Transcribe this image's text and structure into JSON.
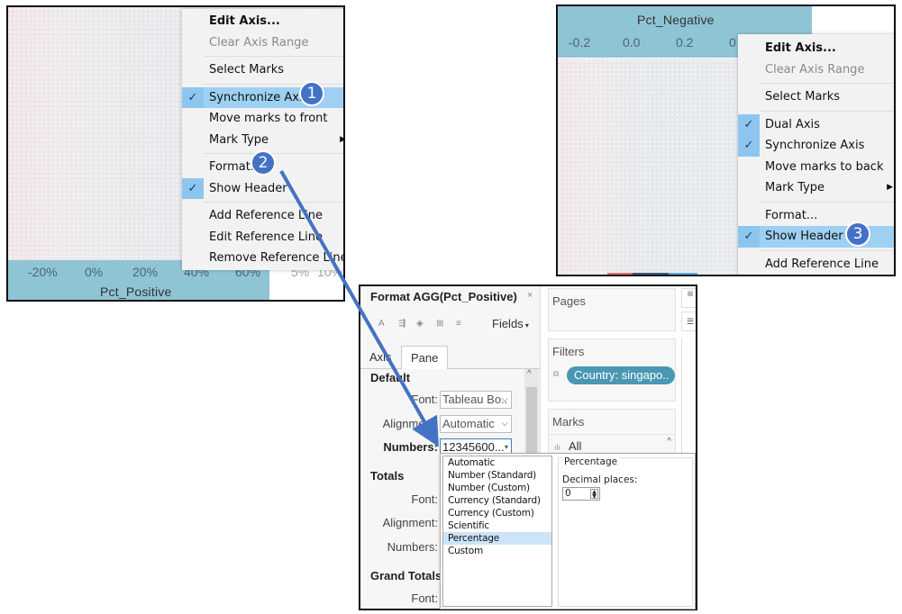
{
  "left_panel": {
    "axis_ticks": [
      "-20%",
      "0%",
      "20%",
      "40%",
      "60%"
    ],
    "secondary_ticks": [
      "5%",
      "10%"
    ],
    "axis_title": "Pct_Positive",
    "context_menu": {
      "items": [
        {
          "label": "Edit Axis...",
          "style": "bold",
          "checked": false
        },
        {
          "label": "Clear Axis Range",
          "style": "disabled",
          "checked": false
        },
        {
          "sep": true
        },
        {
          "label": "Select Marks",
          "checked": false
        },
        {
          "sep": true
        },
        {
          "label": "Synchronize Axis",
          "checked": true,
          "highlighted": true
        },
        {
          "label": "Move marks to front",
          "checked": false
        },
        {
          "label": "Mark Type",
          "checked": false,
          "submenu": true
        },
        {
          "sep": true
        },
        {
          "label": "Format...",
          "checked": false
        },
        {
          "label": "Show Header",
          "checked": true
        },
        {
          "sep": true
        },
        {
          "label": "Add Reference Line",
          "checked": false
        },
        {
          "label": "Edit Reference Line",
          "checked": false
        },
        {
          "label": "Remove Reference Line",
          "checked": false
        }
      ]
    },
    "badges": [
      "1",
      "2"
    ]
  },
  "right_panel": {
    "axis_title": "Pct_Negative",
    "axis_ticks": [
      "-0.2",
      "0.0",
      "0.2",
      "0"
    ],
    "context_menu": {
      "items": [
        {
          "label": "Edit Axis...",
          "style": "bold",
          "checked": false
        },
        {
          "label": "Clear Axis Range",
          "style": "disabled",
          "checked": false
        },
        {
          "sep": true
        },
        {
          "label": "Select Marks",
          "checked": false
        },
        {
          "sep": true
        },
        {
          "label": "Dual Axis",
          "checked": true
        },
        {
          "label": "Synchronize Axis",
          "checked": true
        },
        {
          "label": "Move marks to back",
          "checked": false
        },
        {
          "label": "Mark Type",
          "checked": false,
          "submenu": true
        },
        {
          "sep": true
        },
        {
          "label": "Format...",
          "checked": false
        },
        {
          "label": "Show Header",
          "checked": true,
          "highlighted": true
        },
        {
          "sep": true
        },
        {
          "label": "Add Reference Line",
          "checked": false
        }
      ]
    },
    "badge": "3"
  },
  "format_pane": {
    "title": "Format AGG(Pct_Positive)",
    "close": "×",
    "toolbar_icons": [
      "font-icon",
      "align-icon",
      "shading-icon",
      "borders-icon",
      "lines-icon"
    ],
    "fields_label": "Fields",
    "tabs": [
      "Axis",
      "Pane"
    ],
    "active_tab": "Pane",
    "sections": {
      "default": {
        "title": "Default",
        "font_label": "Font:",
        "font_value": "Tableau Bo..",
        "alignment_label": "Alignment:",
        "alignment_value": "Automatic",
        "numbers_label": "Numbers:",
        "numbers_value": "12345600..."
      },
      "totals": {
        "title": "Totals",
        "font_label": "Font:",
        "alignment_label": "Alignment:",
        "numbers_label": "Numbers:"
      },
      "grand_totals": {
        "title": "Grand Totals",
        "font_label": "Font:"
      }
    },
    "number_formats": [
      "Automatic",
      "Number (Standard)",
      "Number (Custom)",
      "Currency (Standard)",
      "Currency (Custom)",
      "Scientific",
      "Percentage",
      "Custom"
    ],
    "selected_format": "Percentage",
    "format_group_label": "Percentage",
    "decimal_label": "Decimal places:",
    "decimal_value": "0"
  },
  "shelves": {
    "pages": "Pages",
    "filters": "Filters",
    "filter_pill": "Country: singapo..",
    "marks": "Marks",
    "marks_type": "All"
  },
  "colors": {
    "axis_band": "#8ec4d4",
    "menu_highlight": "#9dd0f2",
    "check_bg": "#8cc6ef",
    "badge": "#4472c4",
    "arrow": "#4472c4",
    "pill": "#4a97b3"
  }
}
